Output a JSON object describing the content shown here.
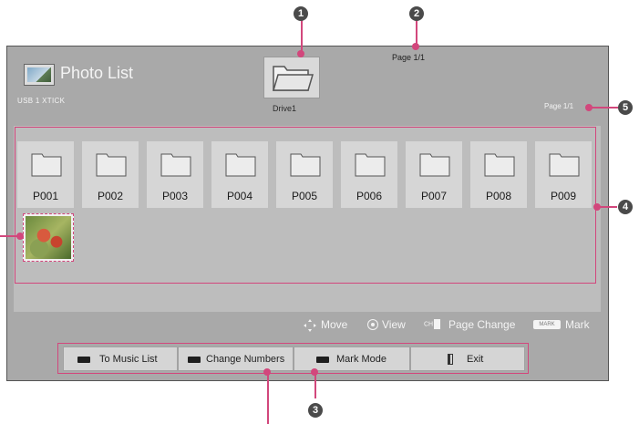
{
  "app": {
    "title": "Photo List",
    "device": "USB 1 XTICK"
  },
  "drive": {
    "label": "Drive1"
  },
  "pagination": {
    "top": "Page 1/1",
    "right": "Page 1/1"
  },
  "folders": [
    "P001",
    "P002",
    "P003",
    "P004",
    "P005",
    "P006",
    "P007",
    "P008",
    "P009"
  ],
  "key_guide": {
    "move": "Move",
    "view": "View",
    "ch_prefix": "CH",
    "page_change": "Page Change",
    "mark_key": "MARK",
    "mark": "Mark"
  },
  "buttons": [
    {
      "label": "To Music List",
      "color": "#1e1e1e"
    },
    {
      "label": "Change Numbers",
      "color": "#1e1e1e"
    },
    {
      "label": "Mark Mode",
      "color": "#1e1e1e"
    },
    {
      "label": "Exit",
      "icon": "exit-icon"
    }
  ],
  "callouts": [
    "1",
    "2",
    "3",
    "4",
    "5"
  ],
  "colors": {
    "accent": "#d2477c",
    "screen": "#a9a9a9",
    "panel": "#bdbdbd",
    "tile": "#d6d6d6"
  }
}
